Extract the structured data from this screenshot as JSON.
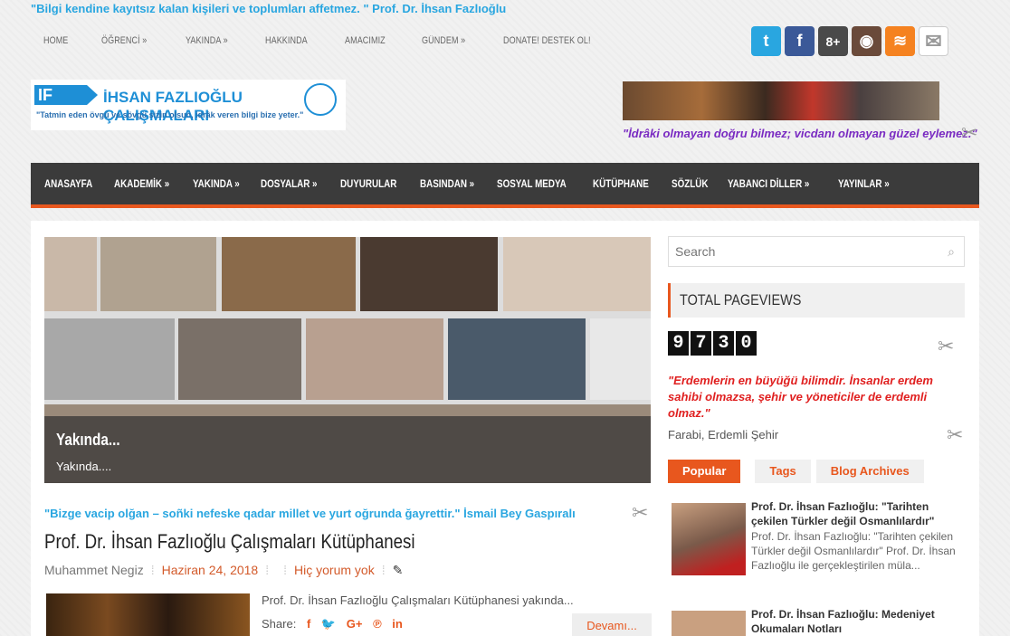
{
  "top_quote": "\"Bilgi kendine kayıtsız kalan kişileri ve toplumları affetmez. \" Prof. Dr. İhsan Fazlıoğlu",
  "top_nav": [
    "HOME",
    "ÖĞRENCİ »",
    "YAKINDA »",
    "HAKKINDA",
    "AMACIMIZ",
    "GÜNDEM »",
    "DONATE! DESTEK OL!"
  ],
  "social": [
    {
      "name": "twitter-icon",
      "color": "#29a6e0",
      "glyph": "t"
    },
    {
      "name": "facebook-icon",
      "color": "#3b5998",
      "glyph": "f"
    },
    {
      "name": "google-plus-icon",
      "color": "#4a4a4a",
      "glyph": "8+"
    },
    {
      "name": "instagram-icon",
      "color": "#6a4a3a",
      "glyph": "◉"
    },
    {
      "name": "rss-icon",
      "color": "#f58220",
      "glyph": "≋"
    },
    {
      "name": "email-icon",
      "color": "#ffffff",
      "glyph": "✉"
    }
  ],
  "logo": {
    "mark": "IF",
    "name": "İHSAN FAZLIOĞLU ÇALIŞMALARI",
    "motto": "\"Tatmin eden övgü ve sövgü sizin olsun, idrâk veren bilgi bize yeter.\""
  },
  "slogan": "\"İdrâki olmayan doğru bilmez; vicdanı olmayan güzel eylemez.\"",
  "main_nav": [
    "ANASAYFA",
    "AKADEMİK »",
    "YAKINDA »",
    "DOSYALAR »",
    "DUYURULAR",
    "BASINDAN »",
    "SOSYAL MEDYA",
    "KÜTÜPHANE",
    "SÖZLÜK",
    "YABANCI DİLLER »",
    "YAYINLAR »"
  ],
  "slider": {
    "title": "Yakında...",
    "subtitle": "Yakında...."
  },
  "quote2": "\"Bizge vacip olğan – soñki nefeske qadar millet ve yurt oğrunda ğayrettir.\" İsmail Bey Gaspıralı",
  "post": {
    "title": "Prof. Dr. İhsan Fazlıoğlu Çalışmaları Kütüphanesi",
    "author": "Muhammet Negiz",
    "date": "Haziran 24, 2018",
    "comments": "Hiç yorum yok",
    "excerpt": "Prof. Dr. İhsan Fazlıoğlu Çalışmaları Kütüphanesi yakında...",
    "share_label": "Share:",
    "more_label": "Devamı..."
  },
  "sidebar": {
    "search_placeholder": "Search",
    "pageviews_title": "TOTAL PAGEVIEWS",
    "pageviews_digits": [
      "9",
      "7",
      "3",
      "0"
    ],
    "farabi_quote": "\"Erdemlerin en büyüğü bilimdir. İnsanlar erdem sahibi olmazsa, şehir ve yöneticiler de erdemli olmaz.\"",
    "farabi_source": "Farabi, Erdemli Şehir",
    "tabs": [
      "Popular",
      "Tags",
      "Blog Archives"
    ],
    "popular": [
      {
        "title": "Prof. Dr. İhsan Fazlıoğlu: \"Tarihten çekilen Türkler değil Osmanlılardır\"",
        "excerpt": "Prof. Dr. İhsan Fazlıoğlu: \"Tarihten çekilen Türkler değil Osmanlılardır\" Prof. Dr. İhsan Fazlıoğlu ile gerçekleştirilen müla..."
      },
      {
        "title": "Prof. Dr. İhsan Fazlıoğlu: Medeniyet Okumaları Notları",
        "excerpt": ""
      }
    ]
  }
}
